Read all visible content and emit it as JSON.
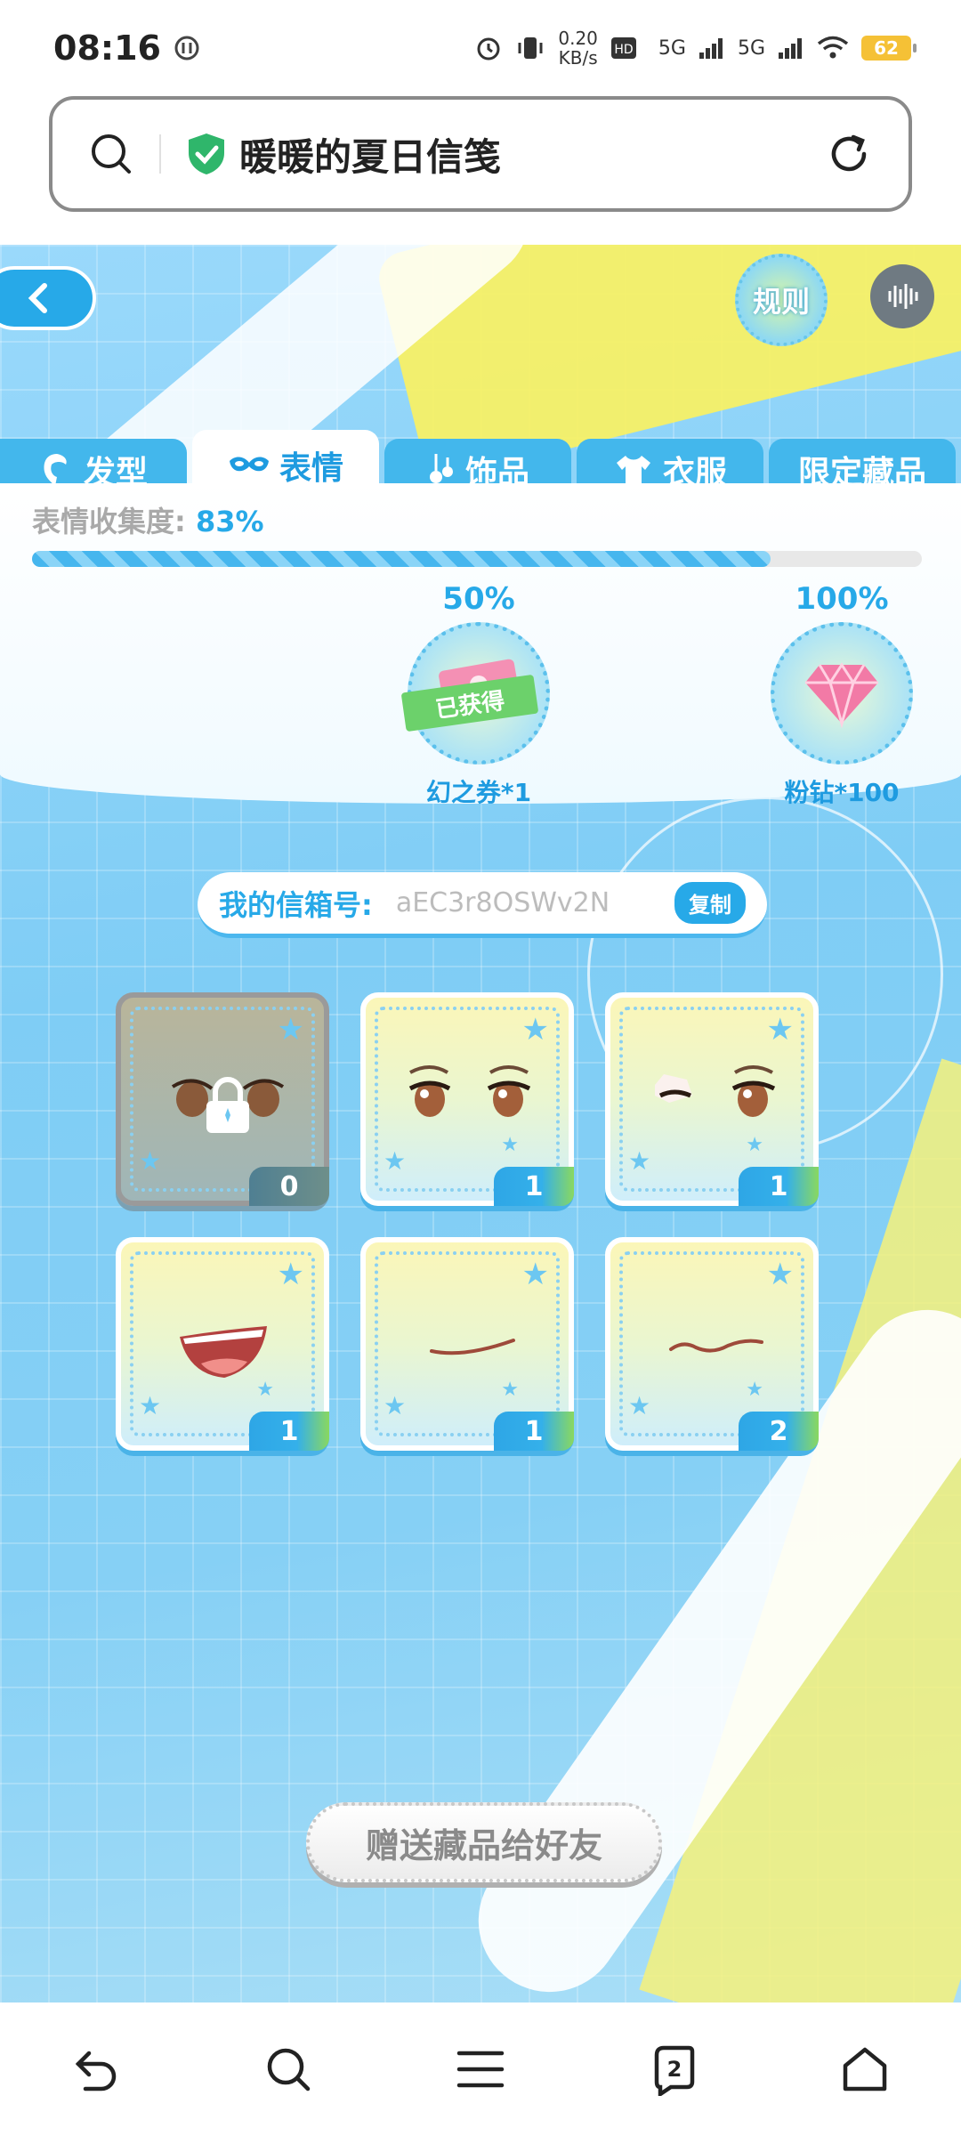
{
  "status_bar": {
    "time": "08:16",
    "net_speed_value": "0.20",
    "net_speed_unit": "KB/s",
    "network_1": "5G",
    "network_2": "5G",
    "battery": "62"
  },
  "address_bar": {
    "title": "暖暖的夏日信笺"
  },
  "game": {
    "rules_label": "规则",
    "tabs": [
      {
        "label": "发型"
      },
      {
        "label": "表情"
      },
      {
        "label": "饰品"
      },
      {
        "label": "衣服"
      },
      {
        "label": "限定藏品"
      }
    ],
    "collection": {
      "label": "表情收集度:",
      "percent": "83%",
      "progress": 0.83
    },
    "milestones": [
      {
        "pct": "50%",
        "name": "幻之券*1",
        "status": "已获得"
      },
      {
        "pct": "100%",
        "name": "粉钻*100"
      }
    ],
    "mailbox": {
      "label": "我的信箱号:",
      "id": "aEC3r8OSWv2N",
      "copy_label": "复制"
    },
    "items": [
      {
        "count": "0",
        "locked": true,
        "kind": "eyes"
      },
      {
        "count": "1",
        "locked": false,
        "kind": "eyes"
      },
      {
        "count": "1",
        "locked": false,
        "kind": "wink"
      },
      {
        "count": "1",
        "locked": false,
        "kind": "mouth-open"
      },
      {
        "count": "1",
        "locked": false,
        "kind": "mouth-smile"
      },
      {
        "count": "2",
        "locked": false,
        "kind": "mouth-wavy"
      }
    ],
    "gift_button": "赠送藏品给好友"
  },
  "bottom_nav": {
    "tab_count": "2"
  },
  "colors": {
    "accent": "#27a9e8",
    "tab_bg": "#43b7ec",
    "yellow": "#f7f066"
  }
}
